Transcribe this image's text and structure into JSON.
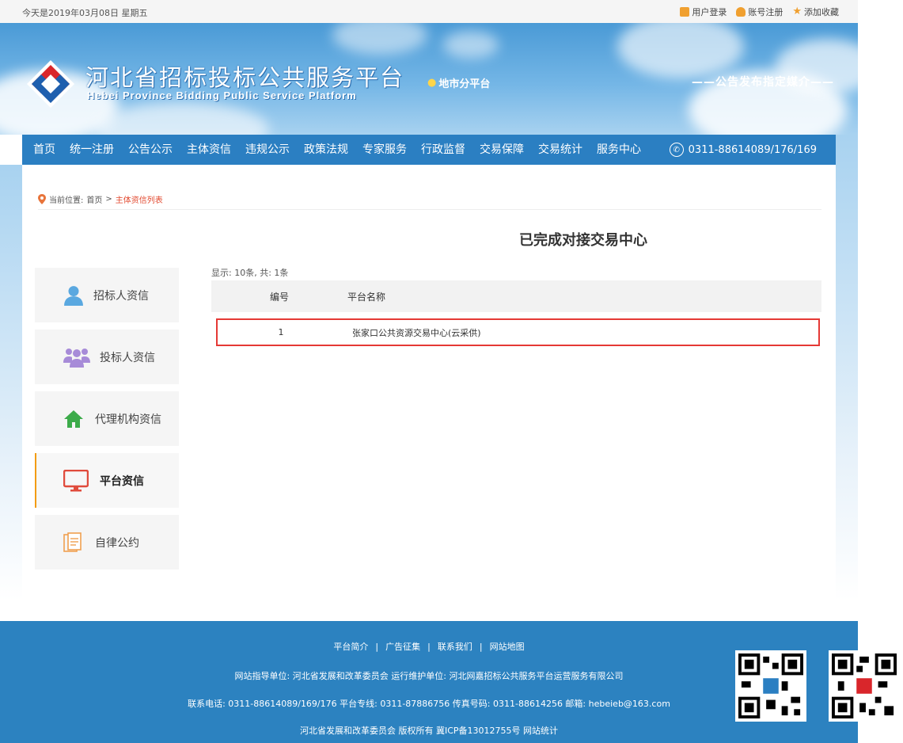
{
  "topbar": {
    "date": "今天是2019年03月08日 星期五",
    "login": "用户登录",
    "register": "账号注册",
    "favorite": "添加收藏"
  },
  "header": {
    "title_cn": "河北省招标投标公共服务平台",
    "title_en": "Hebei Province Bidding Public Service Platform",
    "city_sub": "地市分平台",
    "slogan": "——公告发布指定媒介——"
  },
  "nav": {
    "items": [
      "首页",
      "统一注册",
      "公告公示",
      "主体资信",
      "违规公示",
      "政策法规",
      "专家服务",
      "行政监督",
      "交易保障",
      "交易统计",
      "服务中心"
    ],
    "phone": "0311-88614089/176/169"
  },
  "breadcrumb": {
    "prefix": "当前位置:",
    "home": "首页",
    "sep": ">",
    "current": "主体资信列表"
  },
  "page_title": "已完成对接交易中心",
  "sidebar": {
    "items": [
      {
        "label": "招标人资信",
        "icon": "person-icon",
        "color": "#5aa8e0"
      },
      {
        "label": "投标人资信",
        "icon": "group-icon",
        "color": "#a78bd8"
      },
      {
        "label": "代理机构资信",
        "icon": "home-icon",
        "color": "#3cab4a"
      },
      {
        "label": "平台资信",
        "icon": "monitor-icon",
        "color": "#e04b3c"
      },
      {
        "label": "自律公约",
        "icon": "document-icon",
        "color": "#f0a050"
      }
    ],
    "active_index": 3
  },
  "table": {
    "count_text": "显示: 10条, 共: 1条",
    "headers": [
      "编号",
      "平台名称"
    ],
    "rows": [
      {
        "no": "1",
        "name": "张家口公共资源交易中心(云采供)"
      }
    ]
  },
  "footer": {
    "links": [
      "平台简介",
      "广告征集",
      "联系我们",
      "网站地图"
    ],
    "line2": "网站指导单位: 河北省发展和改革委员会   运行维护单位: 河北网嘉招标公共服务平台运营服务有限公司",
    "line3": "联系电话: 0311-88614089/169/176   平台专线: 0311-87886756   传真号码: 0311-88614256   邮箱: hebeieb@163.com",
    "line4": "河北省发展和改革委员会 版权所有   冀ICP备13012755号   网站统计"
  },
  "colors": {
    "nav": "#2b7fc2",
    "footer": "#2c82c0",
    "accent_red": "#e53935",
    "active_bar": "#f39c12"
  }
}
